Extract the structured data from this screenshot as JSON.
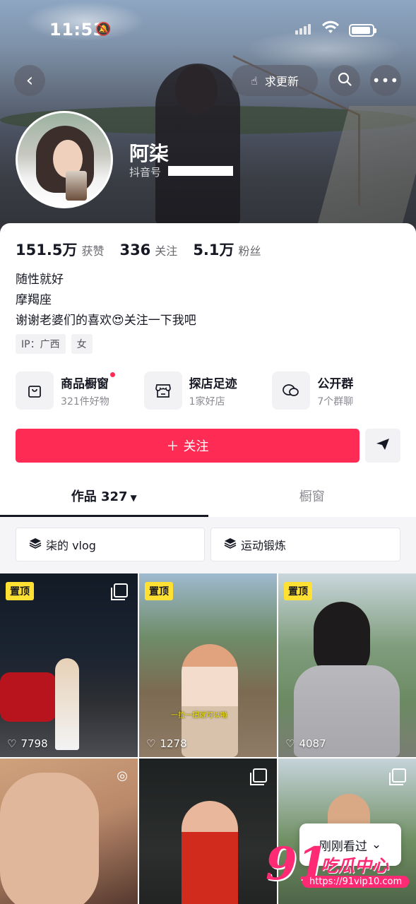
{
  "status_bar": {
    "time": "11:53"
  },
  "header": {
    "update_label": "求更新",
    "username": "阿柒",
    "douyin_id_label": "抖音号"
  },
  "stats": [
    {
      "value": "151.5万",
      "label": "获赞"
    },
    {
      "value": "336",
      "label": "关注"
    },
    {
      "value": "5.1万",
      "label": "粉丝"
    }
  ],
  "bio": [
    "随性就好",
    "摩羯座",
    "谢谢老婆们的喜欢😍关注一下我吧"
  ],
  "tags": [
    "IP：广西",
    "女"
  ],
  "features": [
    {
      "title": "商品橱窗",
      "sub": "321件好物",
      "icon": "shopping-bag-icon"
    },
    {
      "title": "探店足迹",
      "sub": "1家好店",
      "icon": "store-icon"
    },
    {
      "title": "公开群",
      "sub": "7个群聊",
      "icon": "chat-icon"
    }
  ],
  "follow_label": "关注",
  "tabs": {
    "works_label": "作品 327",
    "showcase_label": "橱窗"
  },
  "collections": [
    "柒的 vlog",
    "运动锻炼"
  ],
  "videos": [
    {
      "pinned": "置顶",
      "likes": "7798"
    },
    {
      "pinned": "置顶",
      "likes": "1278"
    },
    {
      "pinned": "置顶",
      "likes": "4087"
    },
    {
      "pinned": "",
      "likes": ""
    },
    {
      "pinned": "",
      "likes": ""
    },
    {
      "pinned": "",
      "likes": ""
    }
  ],
  "video_caption": "一拉一扭就可以啦",
  "recently_viewed_label": "刚刚看过",
  "watermark": {
    "brand_number": "91",
    "brand_name": "吃瓜中心",
    "url": "https://91vip10.com"
  },
  "colors": {
    "accent": "#fe2c55",
    "pin": "#ffe033",
    "watermark": "#ff2a74"
  }
}
